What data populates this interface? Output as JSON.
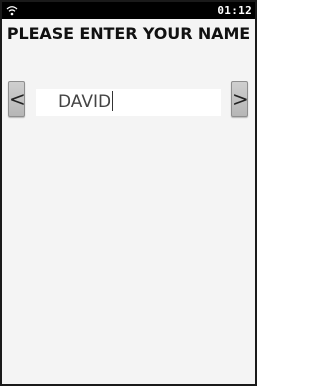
{
  "status_bar": {
    "wifi_icon": "wifi-icon",
    "time": "01:12"
  },
  "screen": {
    "title": "PLEASE ENTER YOUR NAME",
    "prev_label": "<",
    "next_label": ">",
    "name_value": "DAVID"
  },
  "colors": {
    "status_bar": "#000000",
    "background": "#f4f4f4",
    "button": "#c4c4c4"
  }
}
